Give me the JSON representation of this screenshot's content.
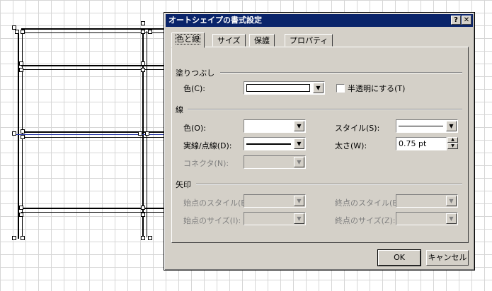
{
  "dialog": {
    "title": "オートシェイプの書式設定",
    "help_button": "?",
    "close_button": "✕"
  },
  "tabs": [
    {
      "label": "色と線"
    },
    {
      "label": "サイズ"
    },
    {
      "label": "保護"
    },
    {
      "label": "プロパティ"
    }
  ],
  "fill": {
    "section": "塗りつぶし",
    "color_label": "色(C):",
    "semi_transparent_label": "半透明にする(T)"
  },
  "line": {
    "section": "線",
    "color_label": "色(O):",
    "dash_label": "実線/点線(D):",
    "connector_label": "コネクタ(N):",
    "style_label": "スタイル(S):",
    "weight_label": "太さ(W):",
    "weight_value": "0.75 pt"
  },
  "arrows": {
    "section": "矢印",
    "begin_style_label": "始点のスタイル(B):",
    "begin_size_label": "始点のサイズ(I):",
    "end_style_label": "終点のスタイル(E):",
    "end_size_label": "終点のサイズ(Z):"
  },
  "buttons": {
    "ok": "OK",
    "cancel": "キャンセル"
  },
  "icons": {
    "dropdown": "▼",
    "spin_up": "▲",
    "spin_down": "▼"
  }
}
